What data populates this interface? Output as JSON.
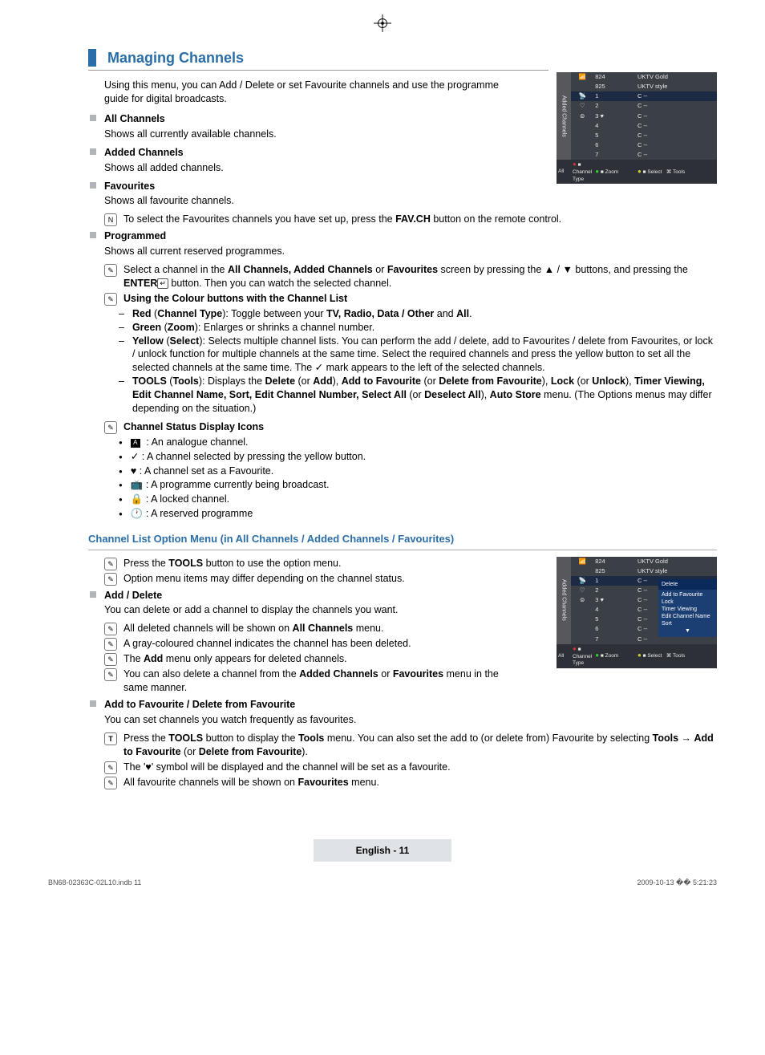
{
  "title": "Managing Channels",
  "intro": "Using this menu, you can Add / Delete or set Favourite channels and use the programme guide for digital broadcasts.",
  "sec_all_channels": {
    "h": "All Channels",
    "p": "Shows all currently available channels."
  },
  "sec_added": {
    "h": "Added Channels",
    "p": "Shows all added channels."
  },
  "sec_fav": {
    "h": "Favourites",
    "p": "Shows all favourite channels."
  },
  "fav_note_pre": "To select the Favourites channels you have set up, press the ",
  "fav_note_b": "FAV.CH",
  "fav_note_post": " button on the remote control.",
  "sec_prog": {
    "h": "Programmed",
    "p": "Shows all current reserved programmes."
  },
  "prog_n1_a": "Select a channel in the ",
  "prog_n1_b": "All Channels, Added Channels",
  "prog_n1_c": " or ",
  "prog_n1_d": "Favourites",
  "prog_n1_e": " screen by pressing the ▲ / ▼ buttons, and pressing the ",
  "prog_n1_f": "ENTER",
  "prog_n1_g": " button. Then you can watch the selected channel.",
  "colour_h": "Using the Colour buttons with the Channel List",
  "colour_items": {
    "red_a": "Red",
    "red_b": " (",
    "red_c": "Channel Type",
    "red_d": "): Toggle between your ",
    "red_e": "TV, Radio, Data / Other",
    "red_f": " and ",
    "red_g": "All",
    "red_h": ".",
    "green_a": "Green",
    "green_b": " (",
    "green_c": "Zoom",
    "green_d": "): Enlarges or shrinks a channel number.",
    "yellow_a": "Yellow",
    "yellow_b": " (",
    "yellow_c": "Select",
    "yellow_d": "): Selects multiple channel lists. You can perform the add / delete, add to Favourites / delete from Favourites, or lock / unlock function for multiple channels at the same time. Select the required channels and press the yellow button to set all the selected channels at the same time. The ✓ mark appears to the left of the selected channels.",
    "tools_a": "TOOLS",
    "tools_b": " (",
    "tools_c": "Tools",
    "tools_d": "): Displays the ",
    "tools_e": "Delete",
    "tools_f": " (or ",
    "tools_g": "Add",
    "tools_h": "), ",
    "tools_i": "Add to Favourite",
    "tools_j": " (or ",
    "tools_k": "Delete from Favourite",
    "tools_l": "), ",
    "tools_m": "Lock",
    "tools_n": " (or ",
    "tools_o": "Unlock",
    "tools_p": "), ",
    "tools_q": "Timer Viewing, Edit Channel Name, Sort, Edit Channel Number, Select All",
    "tools_r": " (or ",
    "tools_s": "Deselect All",
    "tools_t": "), ",
    "tools_u": "Auto Store",
    "tools_v": " menu. (The Options menus may differ depending on the situation.)"
  },
  "icons_h": "Channel Status Display Icons",
  "icons": {
    "a": ": An analogue channel.",
    "check": ": A channel selected by pressing the yellow button.",
    "heart": ": A channel set as a Favourite.",
    "tv": ": A programme currently being broadcast.",
    "lock": ": A locked channel.",
    "clock": ": A reserved programme"
  },
  "opt_h": "Channel List Option Menu (in All Channels / Added Channels / Favourites)",
  "opt_n1_a": "Press the ",
  "opt_n1_b": "TOOLS",
  "opt_n1_c": " button to use the option menu.",
  "opt_n2": "Option menu items may differ depending on the channel status.",
  "ad_h": "Add / Delete",
  "ad_p": "You can delete or add a channel to display the channels you want.",
  "ad_n1_a": "All deleted channels will be shown on ",
  "ad_n1_b": "All Channels",
  "ad_n1_c": " menu.",
  "ad_n2": "A gray-coloured channel indicates the channel has been deleted.",
  "ad_n3_a": "The ",
  "ad_n3_b": "Add",
  "ad_n3_c": " menu only appears for deleted channels.",
  "ad_n4_a": "You can also delete a channel from the ",
  "ad_n4_b": "Added Channels",
  "ad_n4_c": " or ",
  "ad_n4_d": "Favourites",
  "ad_n4_e": " menu in the same manner.",
  "af_h": "Add to Favourite / Delete from Favourite",
  "af_p": "You can set channels you watch frequently as favourites.",
  "af_t_a": "Press the ",
  "af_t_b": "TOOLS",
  "af_t_c": " button to display the ",
  "af_t_d": "Tools",
  "af_t_e": " menu. You can also set the add to (or delete from) Favourite by selecting ",
  "af_t_f": "Tools",
  "af_t_g": " → ",
  "af_t_h": "Add to Favourite",
  "af_t_i": " (or ",
  "af_t_j": "Delete from Favourite",
  "af_t_k": ").",
  "af_n1": "The '♥' symbol will be displayed and the channel will be set as a favourite.",
  "af_n2_a": "All favourite channels will be shown on ",
  "af_n2_b": "Favourites",
  "af_n2_c": " menu.",
  "page_footer": "English - 11",
  "tinyL": "BN68-02363C-02L10.indb   11",
  "tinyR": "2009-10-13   �� 5:21:23",
  "osd1": {
    "side": "Added Channels",
    "rows": [
      [
        "",
        "824",
        "UKTV Gold"
      ],
      [
        "",
        "825",
        "UKTV style"
      ],
      [
        "▣",
        "1",
        "C --"
      ],
      [
        "▣",
        "2",
        "C --"
      ],
      [
        "▣",
        "3  ♥",
        "C --"
      ],
      [
        "▣",
        "4",
        "C --"
      ],
      [
        "▣",
        "5",
        "C --"
      ],
      [
        "▣",
        "6",
        "C --"
      ],
      [
        "▣",
        "7",
        "C --"
      ]
    ],
    "foot": [
      "All",
      "■ Channel Type",
      "■ Zoom",
      "■ Select",
      "⌘ Tools"
    ]
  },
  "osd2": {
    "side": "Added Channels",
    "rows": [
      [
        "",
        "824",
        "UKTV Gold"
      ],
      [
        "",
        "825",
        "UKTV style"
      ],
      [
        "▣",
        "1",
        "C --"
      ],
      [
        "▣",
        "2",
        "C --"
      ],
      [
        "▣",
        "3  ♥",
        "C --"
      ],
      [
        "▣",
        "4",
        "C --"
      ],
      [
        "▣",
        "5",
        "C --"
      ],
      [
        "▣",
        "6",
        "C --"
      ],
      [
        "▣",
        "7",
        "C --"
      ]
    ],
    "tools": [
      "Delete",
      "Add to Favourite",
      "Lock",
      "Timer Viewing",
      "Edit Channel Name",
      "Sort",
      "▼"
    ],
    "foot": [
      "All",
      "■ Channel Type",
      "■ Zoom",
      "■ Select",
      "⌘ Tools"
    ]
  }
}
